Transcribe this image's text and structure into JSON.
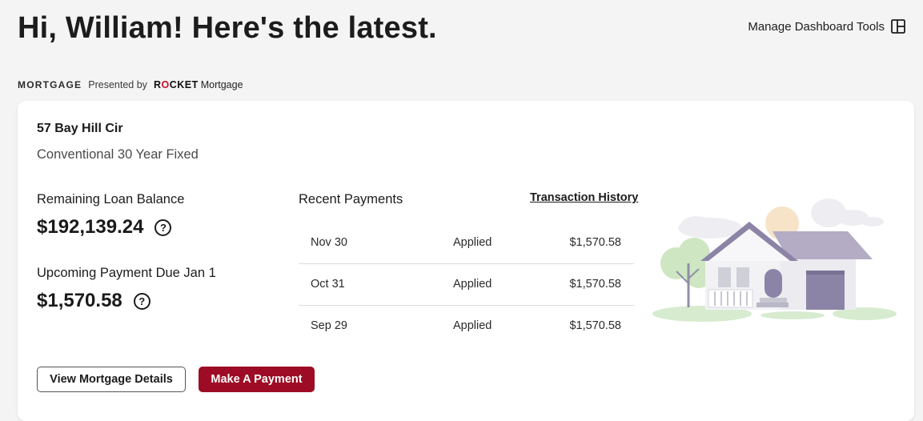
{
  "header": {
    "greeting": "Hi, William! Here's the latest.",
    "manage_tools_label": "Manage Dashboard Tools",
    "manage_tools_icon": "layout-panel-icon"
  },
  "section": {
    "label": "MORTGAGE",
    "presented_by": "Presented by",
    "brand_word": "RCKET",
    "brand_o": "O",
    "brand_suffix": "Mortgage"
  },
  "card": {
    "address": "57 Bay Hill Cir",
    "loan_type": "Conventional 30 Year Fixed",
    "remaining_balance_label": "Remaining Loan Balance",
    "remaining_balance_value": "$192,139.24",
    "upcoming_payment_label": "Upcoming Payment Due Jan 1",
    "upcoming_payment_value": "$1,570.58",
    "help_icon": "question-circle-icon",
    "recent_payments_title": "Recent Payments",
    "transaction_history_link": "Transaction History",
    "payments": [
      {
        "date": "Nov 30",
        "status": "Applied",
        "amount": "$1,570.58"
      },
      {
        "date": "Oct 31",
        "status": "Applied",
        "amount": "$1,570.58"
      },
      {
        "date": "Sep 29",
        "status": "Applied",
        "amount": "$1,570.58"
      }
    ],
    "view_details_button": "View Mortgage Details",
    "make_payment_button": "Make A Payment"
  },
  "colors": {
    "accent": "#9d0c24",
    "brand_red": "#c8102e",
    "page_bg": "#f4f4f4",
    "card_bg": "#ffffff"
  }
}
